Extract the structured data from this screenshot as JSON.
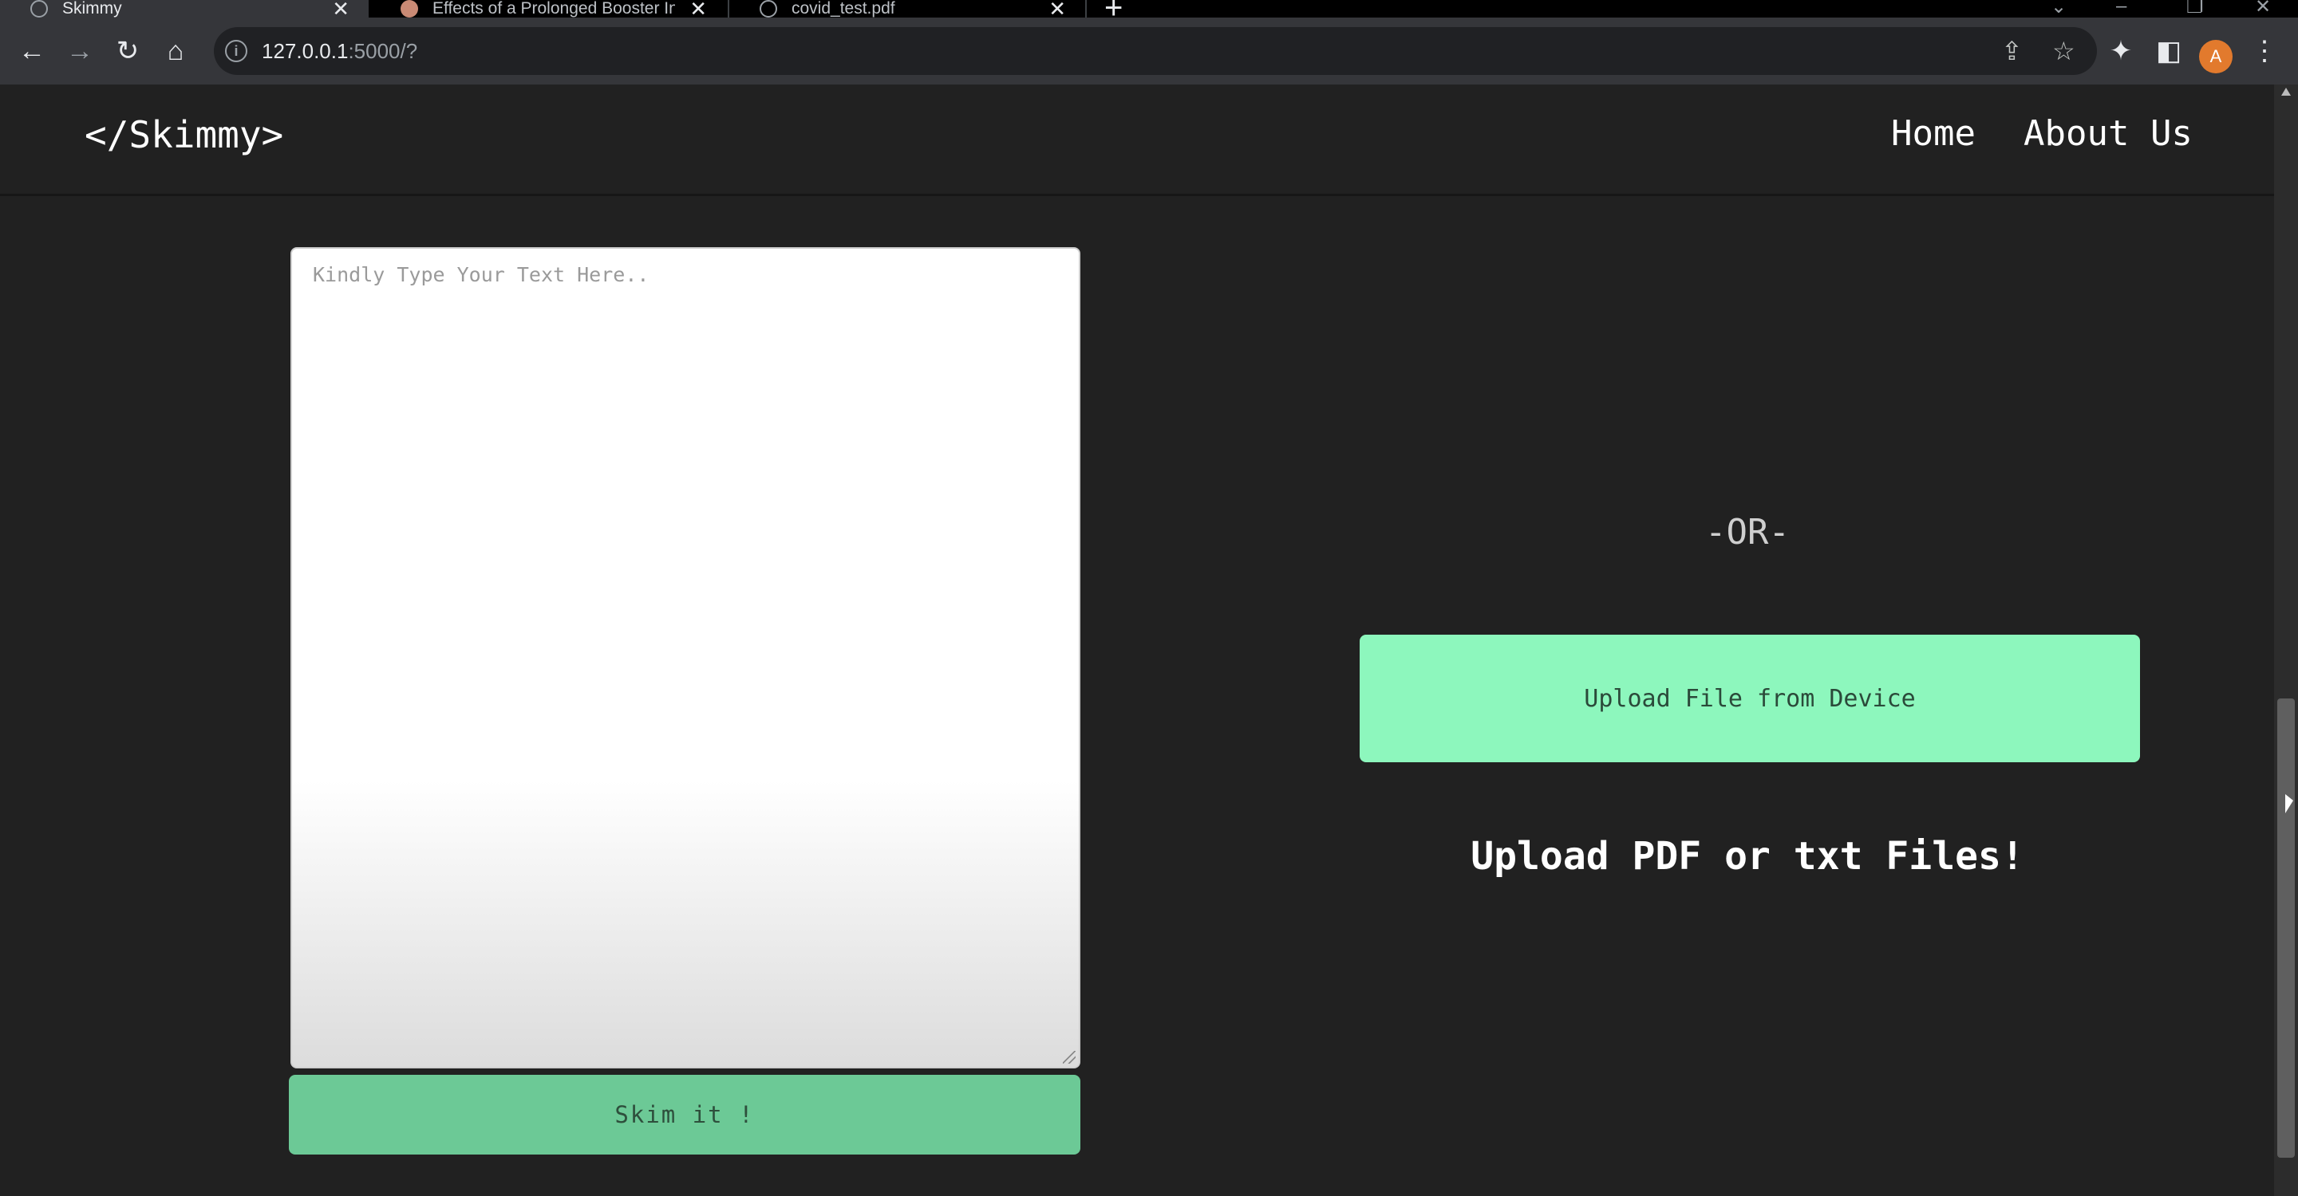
{
  "browser": {
    "tabs": [
      {
        "title": "Skimmy",
        "active": true
      },
      {
        "title": "Effects of a Prolonged Booster In",
        "active": false
      },
      {
        "title": "covid_test.pdf",
        "active": false
      }
    ],
    "new_tab_icon": "plus-icon",
    "url_host": "127.0.0.1",
    "url_path": ":5000/?",
    "profile_initial": "A"
  },
  "page": {
    "brand": "</Skimmy>",
    "nav": {
      "home": "Home",
      "about": "About Us"
    },
    "textarea_placeholder": "Kindly Type Your Text Here..",
    "skim_button": "Skim it !",
    "or_text": "-OR-",
    "upload_button": "Upload File from Device",
    "upload_hint": "Upload PDF or txt Files!"
  },
  "colors": {
    "background": "#212121",
    "upload_button": "#8df7bd",
    "skim_button": "#6cc996"
  }
}
